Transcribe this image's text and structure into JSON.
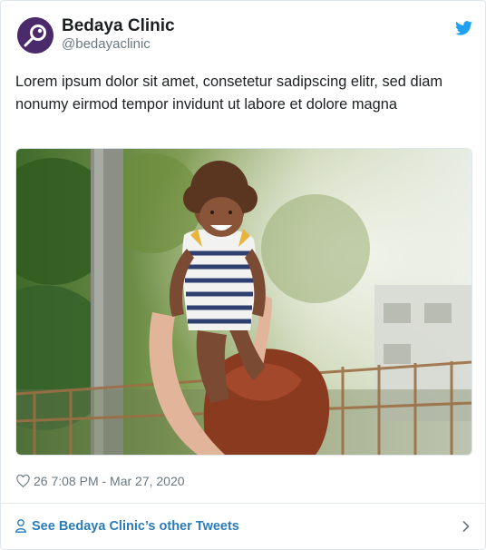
{
  "account": {
    "display_name": "Bedaya Clinic",
    "handle": "@bedayaclinic",
    "avatar_icon": "clinic-logo-icon",
    "brand_color": "#4b2a6b"
  },
  "tweet": {
    "text": "Lorem ipsum dolor sit amet, consetetur sadipscing elitr, sed diam nonumy eirmod tempor invidunt ut labore et dolore magna",
    "media_description": "",
    "likes": "26",
    "timestamp": "7:08 PM - Mar 27, 2020"
  },
  "footer": {
    "link_label": "See Bedaya Clinic’s other Tweets",
    "link_color": "#2b7bb9"
  },
  "colors": {
    "twitter_blue": "#1da1f2",
    "meta_gray": "#697882",
    "border": "#e1e8ed"
  }
}
